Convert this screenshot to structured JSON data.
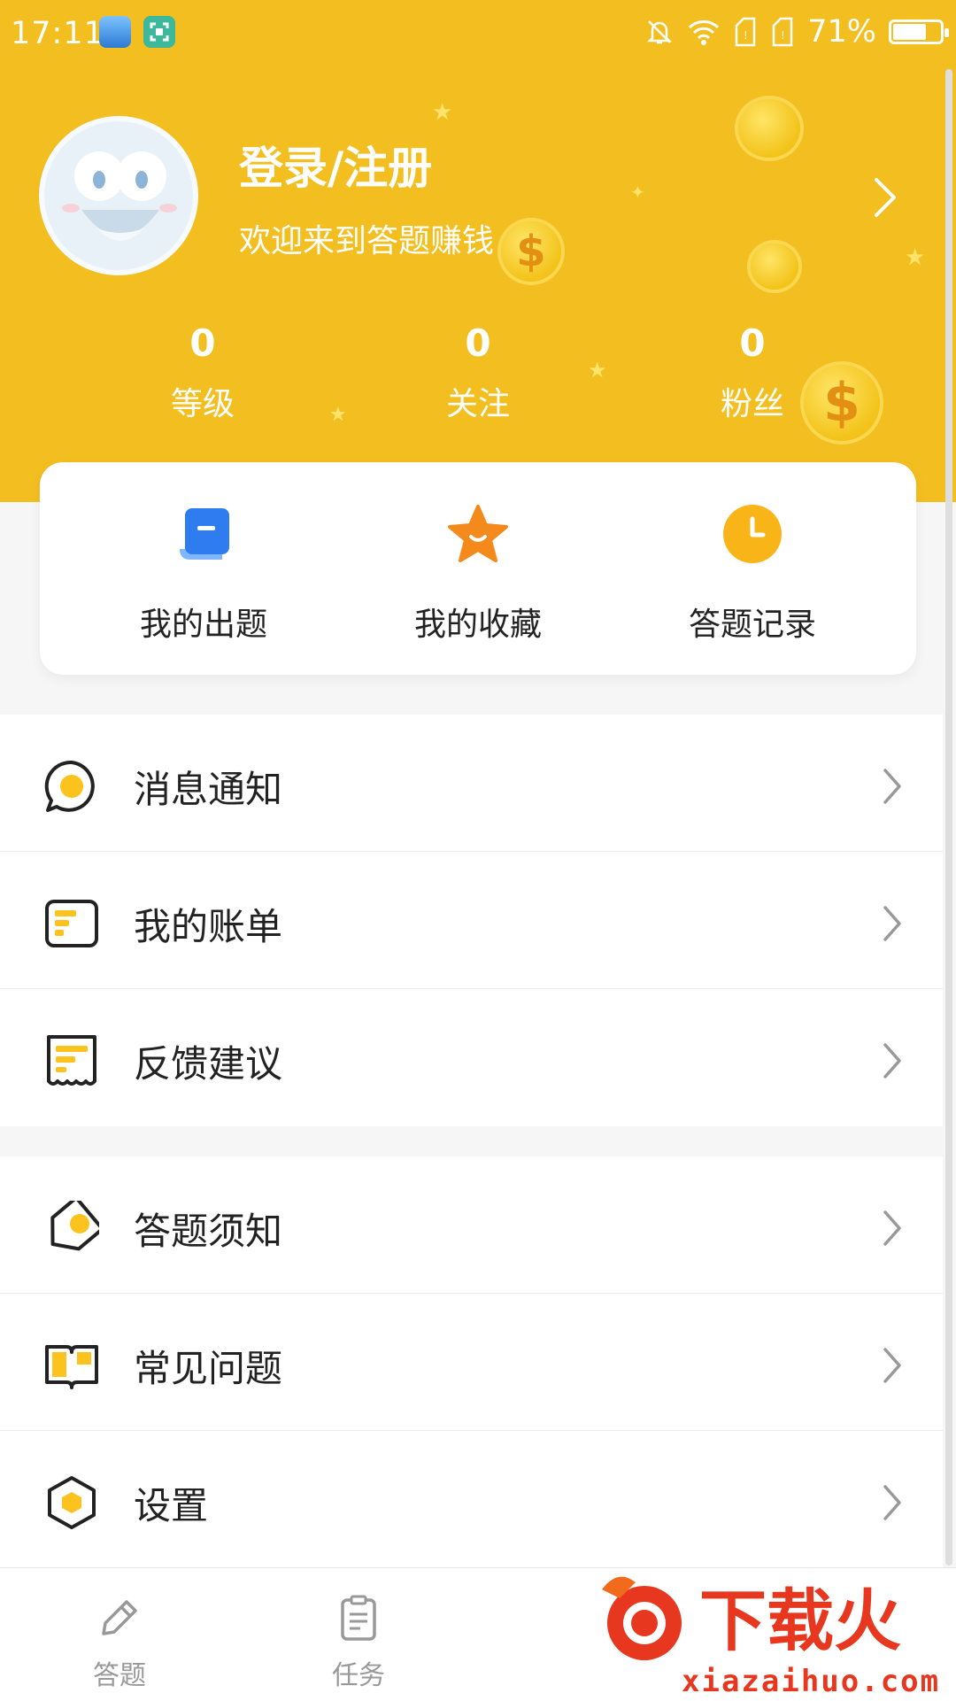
{
  "status_bar": {
    "time": "17:11",
    "battery": "71%",
    "battery_level": 0.71,
    "icons": [
      "gallery-icon",
      "screenshot-icon",
      "mute-bell-icon",
      "wifi-icon",
      "sim1-icon",
      "sim2-icon",
      "battery-icon"
    ]
  },
  "profile": {
    "title": "登录/注册",
    "subtitle": "欢迎来到答题赚钱",
    "stats": [
      {
        "value": "0",
        "label": "等级"
      },
      {
        "value": "0",
        "label": "关注"
      },
      {
        "value": "0",
        "label": "粉丝"
      }
    ]
  },
  "quick_actions": [
    {
      "label": "我的出题",
      "icon": "my-questions-icon"
    },
    {
      "label": "我的收藏",
      "icon": "favorite-star-icon"
    },
    {
      "label": "答题记录",
      "icon": "clock-icon"
    }
  ],
  "menu_group1": [
    {
      "label": "消息通知",
      "icon": "message-bubble-icon"
    },
    {
      "label": "我的账单",
      "icon": "bill-icon"
    },
    {
      "label": "反馈建议",
      "icon": "feedback-receipt-icon"
    }
  ],
  "menu_group2": [
    {
      "label": "答题须知",
      "icon": "tag-icon"
    },
    {
      "label": "常见问题",
      "icon": "book-icon"
    },
    {
      "label": "设置",
      "icon": "hexagon-settings-icon"
    }
  ],
  "tabbar": [
    {
      "label": "答题",
      "icon": "pencil-icon"
    },
    {
      "label": "任务",
      "icon": "clipboard-icon"
    }
  ],
  "watermark": {
    "logo_text": "下载火",
    "url": "xiazaihuo.com"
  },
  "colors": {
    "brand_yellow": "#f3bf20",
    "accent_blue": "#2f7cf0",
    "accent_orange": "#f48a1c",
    "watermark_red": "#e7381f"
  }
}
